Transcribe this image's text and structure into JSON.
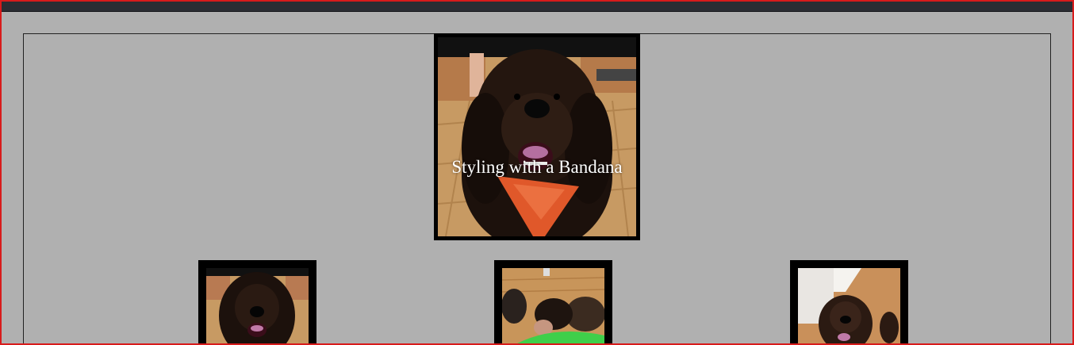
{
  "featured": {
    "caption": "Styling with a Bandana",
    "image": "dog-with-orange-bandana-photo"
  },
  "thumbnails": [
    {
      "image": "dog-portrait-photo"
    },
    {
      "image": "puppies-in-lap-photo"
    },
    {
      "image": "dog-in-hallway-photo"
    }
  ],
  "colors": {
    "page_background": "#b0b0b0",
    "frame_border": "#d81b1b",
    "topbar": "#2b2d33",
    "image_frame": "#000000",
    "caption_text": "#ffffff"
  }
}
